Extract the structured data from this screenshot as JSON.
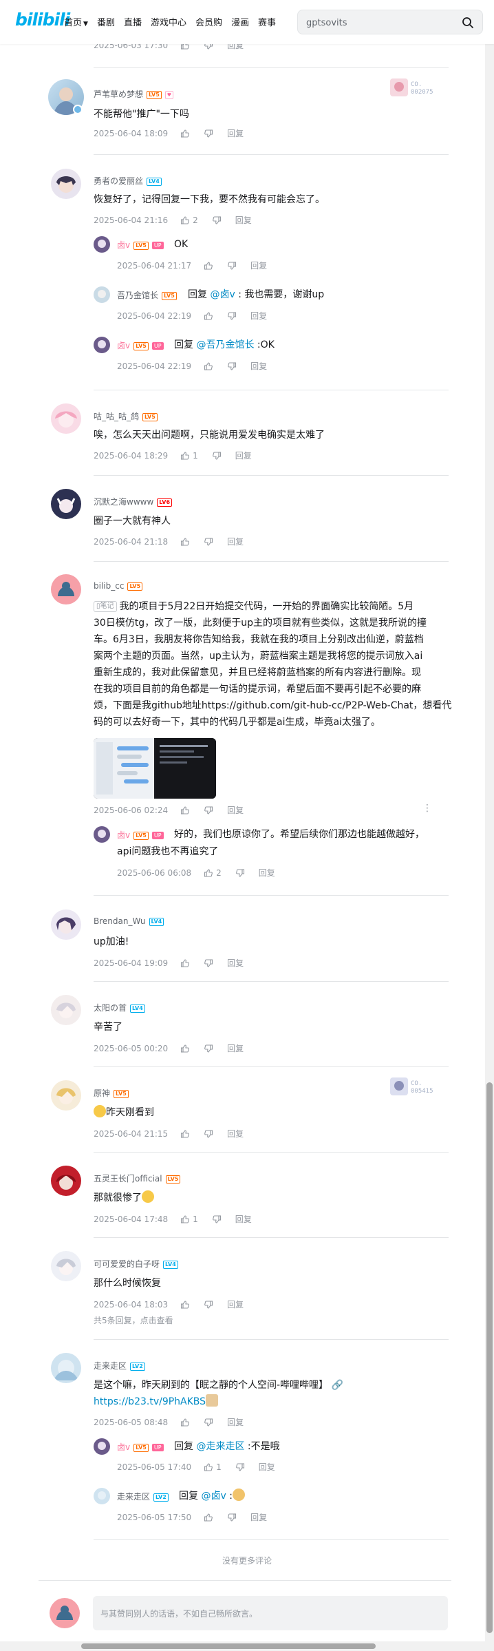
{
  "header": {
    "logo": "bilibili",
    "nav": [
      "首页",
      "番剧",
      "直播",
      "游戏中心",
      "会员购",
      "漫画",
      "赛事"
    ],
    "search_value": "gptsovits"
  },
  "top_partial": {
    "time": "2025-06-03 17:30",
    "reply": "回复"
  },
  "comments": [
    {
      "name": "芦苇草め梦想",
      "level": "LV5",
      "text": "不能帮他\"推广\"一下吗",
      "time": "2025-06-04 18:09",
      "reply": "回复",
      "medal": "CO.\n002075"
    },
    {
      "name": "勇者の爱丽丝",
      "level": "LV4",
      "text": "恢复好了，记得回复一下我，要不然我有可能会忘了。",
      "time": "2025-06-04 21:16",
      "likes": "2",
      "reply": "回复",
      "replies": [
        {
          "name": "卤v",
          "level": "LV5",
          "up": "UP",
          "text": "OK",
          "time": "2025-06-04 21:17",
          "reply": "回复"
        },
        {
          "name": "吾乃金馆长",
          "level": "LV5",
          "prefix": "回复 ",
          "mention": "@卤v",
          "text": " : 我也需要，谢谢up",
          "time": "2025-06-04 22:19",
          "reply": "回复"
        },
        {
          "name": "卤v",
          "level": "LV5",
          "up": "UP",
          "prefix": "回复 ",
          "mention": "@吾乃金馆长",
          "text": " :OK",
          "time": "2025-06-04 22:19",
          "reply": "回复"
        }
      ]
    },
    {
      "name": "咕_咕_咕_鸽",
      "level": "LV5",
      "text": "唉，怎么天天出问题啊，只能说用爱发电确实是太难了",
      "time": "2025-06-04 18:29",
      "likes": "1",
      "reply": "回复"
    },
    {
      "name": "沉默之海wwww",
      "level": "LV6",
      "text": "圈子一大就有神人",
      "time": "2025-06-04 21:18",
      "reply": "回复"
    },
    {
      "name": "bilib_cc",
      "level": "LV5",
      "note_tag": "笔记",
      "text_lines": [
        "我的项目于5月22日开始提交代码，一开始的界面确实比较简陋。5月",
        "30日模仿tg，改了一版，此刻便于up主的项目就有些类似，这就是我所说的撞",
        "车。6月3日，我朋友将你告知给我，我就在我的项目上分别改出仙逆，蔚蓝档",
        "案两个主题的页面。当然，up主认为，蔚蓝档案主题是我将您的提示词放入ai",
        "重新生成的，我对此保留意见，并且已经将蔚蓝档案的所有内容进行删除。现",
        "在我的项目目前的角色都是一句话的提示词，希望后面不要再引起不必要的麻",
        "烦，下面是我github地址https://github.com/git-hub-cc/P2P-Web-Chat，想看代",
        "码的可以去好奇一下，其中的代码几乎都是ai生成，毕竟ai太强了。"
      ],
      "time": "2025-06-06 02:24",
      "reply": "回复",
      "replies": [
        {
          "name": "卤v",
          "level": "LV5",
          "up": "UP",
          "text_lines": [
            "好的，我们也原谅你了。希望后续你们那边也能越做越好，",
            "api问题我也不再追究了"
          ],
          "time": "2025-06-06 06:08",
          "likes": "2",
          "reply": "回复"
        }
      ]
    },
    {
      "name": "Brendan_Wu",
      "level": "LV4",
      "text": "up加油!",
      "time": "2025-06-04 19:09",
      "reply": "回复"
    },
    {
      "name": "太阳の首",
      "level": "LV4",
      "text": "辛苦了",
      "time": "2025-06-05 00:20",
      "reply": "回复"
    },
    {
      "name": "原神",
      "level": "LV5",
      "text": "昨天刚看到",
      "time": "2025-06-04 21:15",
      "reply": "回复",
      "medal": "CO.\n005415"
    },
    {
      "name": "五灵王长门official",
      "level": "LV5",
      "text": "那就很惨了",
      "time": "2025-06-04 17:48",
      "likes": "1",
      "reply": "回复"
    },
    {
      "name": "可可爱爱的白子呀",
      "level": "LV4",
      "text": "那什么时候恢复",
      "time": "2025-06-04 18:03",
      "reply": "回复",
      "view_more": "共5条回复，点击查看"
    },
    {
      "name": "走来走区",
      "level": "LV2",
      "text": "是这个嘛，昨天刷到的【眠之靜的个人空间-哔哩哔哩】",
      "link": "https://b23.tv/9PhAKBS",
      "time": "2025-06-05 08:48",
      "reply": "回复",
      "replies": [
        {
          "name": "卤v",
          "level": "LV5",
          "up": "UP",
          "prefix": "回复 ",
          "mention": "@走来走区",
          "text": " :不是哦",
          "time": "2025-06-05 17:40",
          "likes": "1",
          "reply": "回复"
        },
        {
          "name": "走来走区",
          "level": "LV2",
          "prefix": "回复 ",
          "mention": "@卤v",
          "text": " :",
          "time": "2025-06-05 17:50",
          "reply": "回复"
        }
      ]
    }
  ],
  "no_more": "没有更多评论",
  "bottom_input_placeholder": "与其赞同别人的话语，不如自己畅所欲言。",
  "colors": {
    "brand": "#00aeec",
    "mention": "#008ac5",
    "up": "#ff6699"
  }
}
